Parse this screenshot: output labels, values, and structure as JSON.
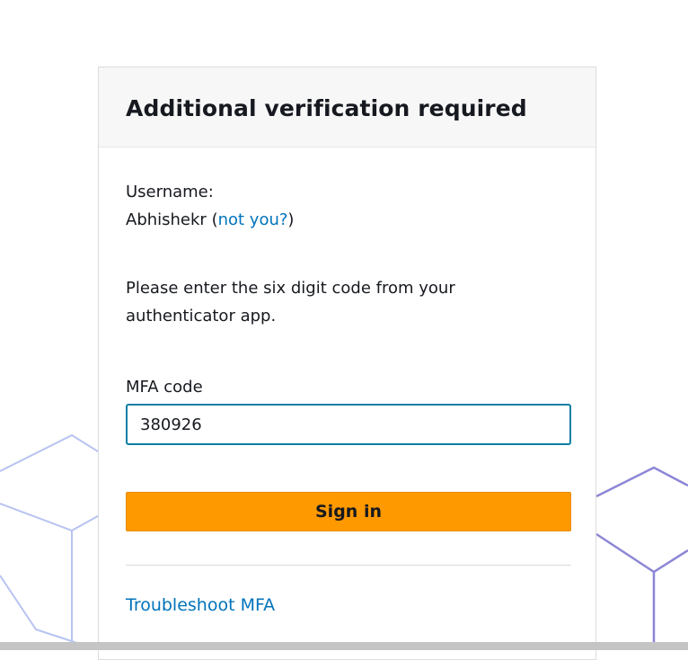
{
  "header": {
    "title": "Additional verification required"
  },
  "user": {
    "label": "Username:",
    "name": "Abhishekr",
    "open_paren": " (",
    "not_you_link": "not you?",
    "close_paren": ")"
  },
  "instructions": "Please enter the six digit code from your authenticator app.",
  "mfa": {
    "label": "MFA code",
    "value": "380926"
  },
  "buttons": {
    "sign_in": "Sign in"
  },
  "links": {
    "troubleshoot": "Troubleshoot MFA"
  },
  "colors": {
    "accent_button": "#ff9900",
    "link": "#0073bb",
    "input_focus": "#0a7ea4"
  }
}
